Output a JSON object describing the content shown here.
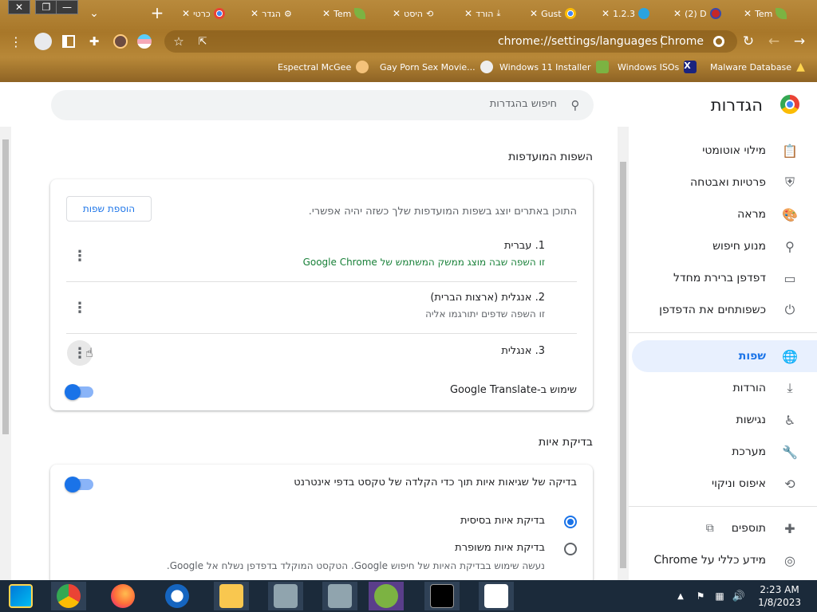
{
  "browser": {
    "tabs": [
      {
        "title": "כרטי",
        "icon": "chrome-icon"
      },
      {
        "title": "הגדר",
        "icon": "gear-icon"
      },
      {
        "title": "Tem",
        "icon": "leaf-icon"
      },
      {
        "title": "היסט",
        "icon": "history-icon"
      },
      {
        "title": "הורד",
        "icon": "download-icon"
      },
      {
        "title": "Gust",
        "icon": "chrome-icon"
      },
      {
        "title": "1.2.3",
        "icon": "telegram-icon"
      },
      {
        "title": "(2) D",
        "icon": "app-icon"
      },
      {
        "title": "Tem",
        "icon": "leaf-icon"
      }
    ],
    "new_tab": "+",
    "tab_close": "✕",
    "url": "chrome://settings/languages",
    "site_label": "Chrome",
    "bookmarks": [
      "Espectral McGee",
      "Gay Porn Sex Movie...",
      "Windows 11 Installer",
      "Windows ISOs",
      "Malware Database"
    ]
  },
  "settings": {
    "title": "הגדרות",
    "search_placeholder": "חיפוש בהגדרות",
    "nav": [
      {
        "label": "מילוי אוטומטי",
        "icon": "clipboard-icon"
      },
      {
        "label": "פרטיות ואבטחה",
        "icon": "shield-icon"
      },
      {
        "label": "מראה",
        "icon": "palette-icon"
      },
      {
        "label": "מנוע חיפוש",
        "icon": "search-icon"
      },
      {
        "label": "דפדפן ברירת מחדל",
        "icon": "browser-icon"
      },
      {
        "label": "כשפותחים את הדפדפן",
        "icon": "power-icon"
      },
      {
        "label": "שפות",
        "icon": "globe-icon"
      },
      {
        "label": "הורדות",
        "icon": "download-icon"
      },
      {
        "label": "נגישות",
        "icon": "accessibility-icon"
      },
      {
        "label": "מערכת",
        "icon": "wrench-icon"
      },
      {
        "label": "איפוס וניקוי",
        "icon": "reset-icon"
      },
      {
        "label": "תוספים",
        "icon": "puzzle-icon"
      },
      {
        "label": "מידע כללי על Chrome",
        "icon": "chrome-icon"
      }
    ],
    "active_nav": "שפות",
    "preferred": {
      "title": "השפות המועדפות",
      "description": "התוכן באתרים יוצג בשפות המועדפות שלך כשזה יהיה אפשרי.",
      "add_button": "הוספת שפות",
      "languages": [
        {
          "name": "1. עברית",
          "note": "זו השפה שבה מוצג ממשק המשתמש של Google Chrome",
          "note_color": "#188038"
        },
        {
          "name": "2. אנגלית (ארצות הברית)",
          "note": "זו השפה שדפים יתורגמו אליה",
          "note_color": "#5f6368"
        },
        {
          "name": "3. אנגלית",
          "note": ""
        }
      ],
      "translate_label": "שימוש ב-Google Translate",
      "translate_on": false
    },
    "spellcheck": {
      "title": "בדיקת איות",
      "toggle_label": "בדיקה של שגיאות איות תוך כדי הקלדה של טקסט בדפי אינטרנט",
      "toggle_on": false,
      "options": [
        {
          "label": "בדיקת איות בסיסית",
          "desc": "",
          "selected": true
        },
        {
          "label": "בדיקת איות משופרת",
          "desc": "נעשה שימוש בבדיקת האיות של חיפוש Google. הטקסט המוקלד בדפדפן נשלח אל Google.",
          "selected": false
        }
      ]
    }
  },
  "taskbar": {
    "time": "2:23 AM",
    "date": "1/8/2023"
  },
  "colors": {
    "accent": "#1a73e8",
    "frame": "#a87729"
  }
}
